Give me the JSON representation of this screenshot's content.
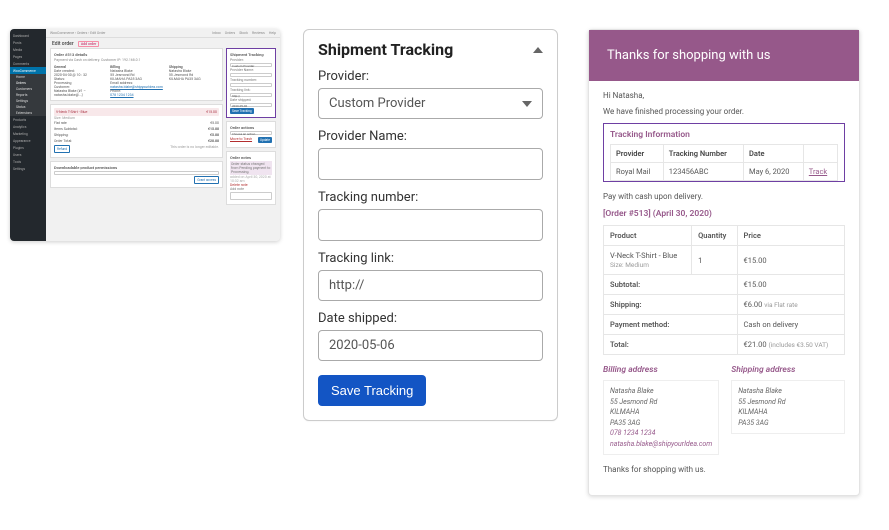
{
  "admin": {
    "sidebar": {
      "items": [
        {
          "label": "Dashboard"
        },
        {
          "label": "Posts"
        },
        {
          "label": "Media"
        },
        {
          "label": "Pages"
        },
        {
          "label": "Comments"
        }
      ],
      "woo_label": "WooCommerce",
      "woo_subs": [
        {
          "label": "Home"
        },
        {
          "label": "Orders",
          "selected": true,
          "dot": true
        },
        {
          "label": "Customers"
        },
        {
          "label": "Reports"
        },
        {
          "label": "Settings"
        },
        {
          "label": "Status"
        },
        {
          "label": "Extensions"
        }
      ],
      "post_items": [
        {
          "label": "Products"
        },
        {
          "label": "Analytics"
        },
        {
          "label": "Marketing"
        },
        {
          "label": "Appearance"
        },
        {
          "label": "Plugins"
        },
        {
          "label": "Users"
        },
        {
          "label": "Tools"
        },
        {
          "label": "Settings"
        }
      ]
    },
    "breadcrumb": "WooCommerce › Orders › Edit Order",
    "top_icons": {
      "inbox": "Inbox",
      "orders": "Orders",
      "stock": "Stock",
      "reviews": "Reviews",
      "help": "Help"
    },
    "title": "Edit order",
    "add_order": "Add order",
    "order_block": {
      "heading": "Order #513 details",
      "sub": "Payment via Cash on delivery. Customer IP: 192.168.0.1",
      "general_label": "General",
      "date_created": "Date created:",
      "date_value": "2020-04-30  @  10 : 32",
      "status_label": "Status:",
      "status_value": "Processing",
      "customer_label": "Customer:",
      "customer_value": "Natasha Blake (#1 – natasha.blake@...)",
      "billing_label": "Billing",
      "billing_text": "Natasha Blake\n55 Jesmond Rd\nKILMAHA PA35 3AG",
      "email_label": "Email address:",
      "email_value": "natasha.blake@shipyourIdea.com",
      "phone_label": "Phone:",
      "phone_value": "078 1234 1234",
      "shipping_label": "Shipping",
      "shipping_text": "Natasha Blake\n55 Jesmond Rd\nKILMAHA PA35 3AG"
    },
    "items_block": {
      "product": "V-Neck T-Shirt - Blue",
      "size": "Size: Medium",
      "cost": "€15.00",
      "qty": "× 1",
      "total": "€15.00",
      "flat": "Flat rate",
      "flat_cost": "€5.00",
      "sub_l": "Items Subtotal:",
      "sub_v": "€15.00",
      "ship_l": "Shipping:",
      "ship_v": "€5.00",
      "ot_l": "Order Total:",
      "ot_v": "€20.00",
      "refund_btn": "Refund",
      "single_note": "This order is no longer editable."
    },
    "dl_block": {
      "title": "Downloadable product permissions",
      "grant": "Grant access"
    },
    "ship_box": {
      "title": "Shipment Tracking",
      "prov_l": "Provider:",
      "prov_v": "Custom Provider",
      "pname_l": "Provider Name:",
      "tnum_l": "Tracking number:",
      "tlink_l": "Tracking link:",
      "tlink_v": "http://",
      "date_l": "Date shipped:",
      "date_v": "2020-05-06",
      "btn": "Save Tracking"
    },
    "oa_box": {
      "title": "Order actions",
      "choose": "Choose an action...",
      "trash": "Move to Trash",
      "update": "Update"
    },
    "on_box": {
      "title": "Order notes",
      "note": "Order status changed from Pending payment to Processing.",
      "added": "added on April 30, 2020 at 10:32 am",
      "delete": "Delete note",
      "addnote": "Add note"
    }
  },
  "tracking": {
    "title": "Shipment Tracking",
    "provider_label": "Provider:",
    "provider_value": "Custom Provider",
    "provider_name_label": "Provider Name:",
    "tracking_number_label": "Tracking number:",
    "tracking_link_label": "Tracking link:",
    "tracking_link_value": "http://",
    "date_shipped_label": "Date shipped:",
    "date_shipped_value": "2020-05-06",
    "save_button": "Save Tracking"
  },
  "email": {
    "header": "Thanks for shopping with us",
    "hi": "Hi Natasha,",
    "finished": "We have finished processing your order.",
    "tinfo_title": "Tracking Information",
    "th_provider": "Provider",
    "th_number": "Tracking Number",
    "th_date": "Date",
    "row_provider": "Royal Mail",
    "row_number": "123456ABC",
    "row_date": "May 6, 2020",
    "row_track": "Track",
    "pay_note": "Pay with cash upon delivery.",
    "order_heading": "[Order #513] (April 30, 2020)",
    "oth_product": "Product",
    "oth_qty": "Quantity",
    "oth_price": "Price",
    "item_name": "V-Neck T-Shirt - Blue",
    "item_meta": "Size: Medium",
    "item_qty": "1",
    "item_price": "€15.00",
    "r_subtotal_l": "Subtotal:",
    "r_subtotal_v": "€15.00",
    "r_shipping_l": "Shipping:",
    "r_shipping_v": "€6.00 ",
    "r_shipping_note": "via Flat rate",
    "r_paym_l": "Payment method:",
    "r_paym_v": "Cash on delivery",
    "r_total_l": "Total:",
    "r_total_v": "€21.00 ",
    "r_total_note": "(includes €3.50 VAT)",
    "bill_h": "Billing address",
    "ship_h": "Shipping address",
    "addr_name": "Natasha Blake",
    "addr_l1": "55 Jesmond Rd",
    "addr_l2": "KILMAHA",
    "addr_l3": "PA35 3AG",
    "addr_phone": "078 1234 1234",
    "addr_email": "natasha.blake@shipyourIdea.com",
    "footer": "Thanks for shopping with us."
  }
}
